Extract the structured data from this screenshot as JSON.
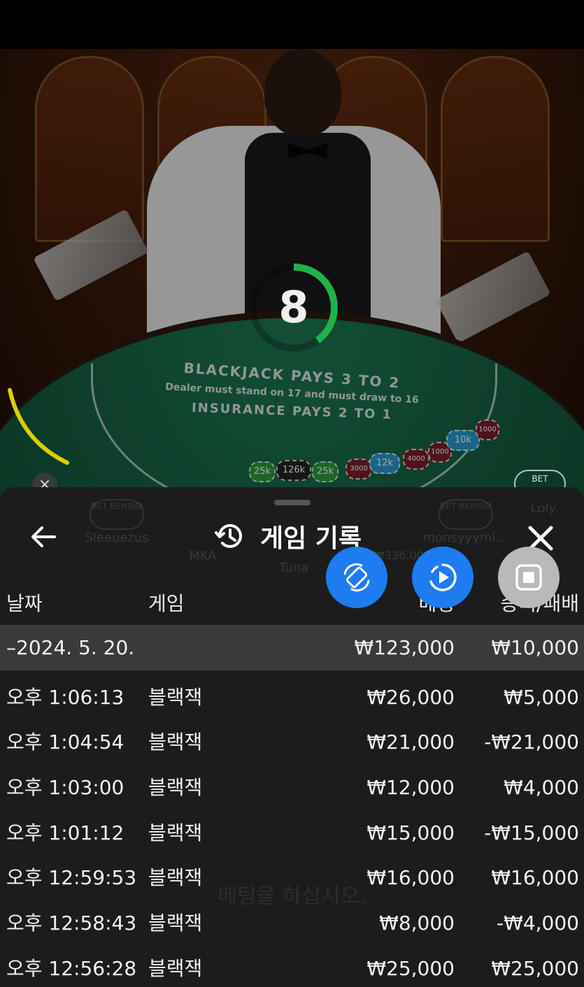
{
  "video": {
    "timer_value": "8",
    "timer_fraction": 0.4,
    "table_line1": "BLACKJACK PAYS 3 TO 2",
    "table_line2": "Dealer must stand on 17 and must draw to 16",
    "table_line3": "INSURANCE PAYS 2 TO 1",
    "chips": [
      "25k",
      "126k",
      "25k",
      "3000",
      "12k",
      "4000",
      "1000",
      "10k",
      "1000"
    ],
    "bet_behind_label": "BET BEHIND",
    "close_glyph": "×",
    "colors": {
      "felt": "#16603f",
      "timer": "#1fb24a",
      "accent_yellow": "#d8d000"
    }
  },
  "background_seats": {
    "players": [
      "Sleeuezus",
      "MKA",
      "Tuna",
      "monsyyymi...",
      "Loly"
    ],
    "bet_amount": "₩336,000",
    "prompt": "베팅을 하십시오."
  },
  "sheet": {
    "title": "게임 기록",
    "back_icon": "arrow-left-icon",
    "history_icon": "history-clock-icon",
    "close_icon": "close-icon",
    "fab_buttons": [
      {
        "name": "rotate-screen-button",
        "icon": "rotate-icon",
        "color": "#1e7bf0"
      },
      {
        "name": "replay-button",
        "icon": "replay-icon",
        "color": "#1e7bf0"
      },
      {
        "name": "stop-button",
        "icon": "stop-icon",
        "color": "#b9b9bb"
      }
    ],
    "columns": {
      "date": "날짜",
      "game": "게임",
      "bet": "베팅",
      "result": "승리/패배"
    },
    "summary": {
      "date": "–2024. 5. 20.",
      "bet": "₩123,000",
      "result": "₩10,000"
    },
    "rows": [
      {
        "time": "오후 1:06:13",
        "game": "블랙잭",
        "bet": "₩26,000",
        "result": "₩5,000"
      },
      {
        "time": "오후 1:04:54",
        "game": "블랙잭",
        "bet": "₩21,000",
        "result": "-₩21,000"
      },
      {
        "time": "오후 1:03:00",
        "game": "블랙잭",
        "bet": "₩12,000",
        "result": "₩4,000"
      },
      {
        "time": "오후 1:01:12",
        "game": "블랙잭",
        "bet": "₩15,000",
        "result": "-₩15,000"
      },
      {
        "time": "오후 12:59:53",
        "game": "블랙잭",
        "bet": "₩16,000",
        "result": "₩16,000"
      },
      {
        "time": "오후 12:58:43",
        "game": "블랙잭",
        "bet": "₩8,000",
        "result": "-₩4,000"
      },
      {
        "time": "오후 12:56:28",
        "game": "블랙잭",
        "bet": "₩25,000",
        "result": "₩25,000"
      }
    ]
  }
}
